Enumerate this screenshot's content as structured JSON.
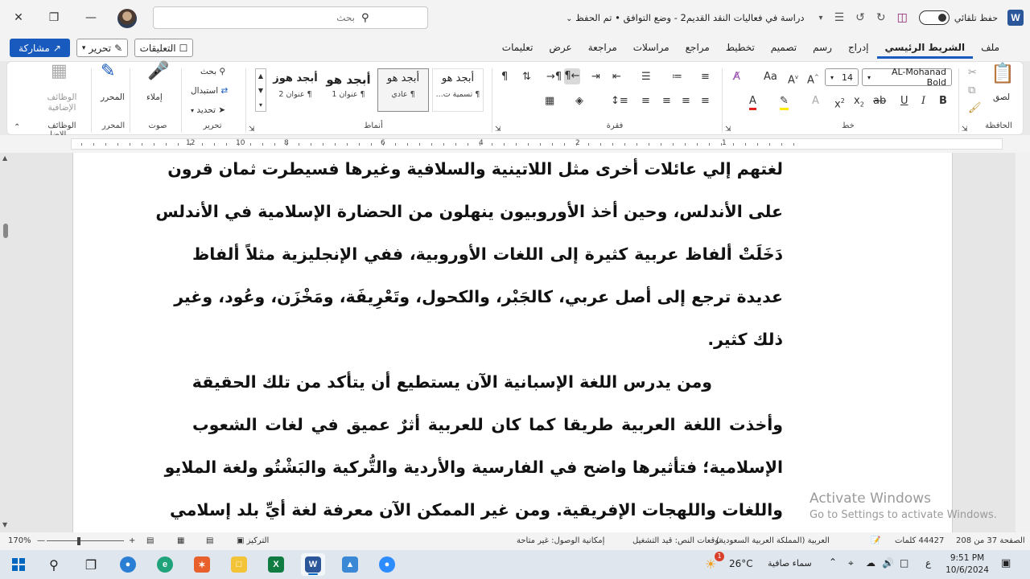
{
  "titlebar": {
    "doc_title": "دراسة في فعاليات النقد القديم2  -  وضع التوافق • تم الحفظ",
    "autosave_label": "حفظ تلقائي",
    "search_placeholder": "بحث",
    "app_letter": "W"
  },
  "tabs": [
    "ملف",
    "الشريط الرئيسي",
    "إدراج",
    "رسم",
    "تصميم",
    "تخطيط",
    "مراجع",
    "مراسلات",
    "مراجعة",
    "عرض",
    "تعليمات"
  ],
  "actions": {
    "share": "مشاركة",
    "edit": "تحرير",
    "comments": "التعليقات"
  },
  "ribbon": {
    "clipboard": {
      "paste": "لصق",
      "label": "الحافظة"
    },
    "font": {
      "name": "AL-Mohanad Bold",
      "size": "14",
      "label": "خط"
    },
    "paragraph": {
      "label": "فقرة"
    },
    "styles": {
      "label": "أنماط",
      "cards": [
        {
          "sample": "أبجد هو",
          "name": "¶ تسمية ت..."
        },
        {
          "sample": "أبجد هو",
          "name": "¶ عادي"
        },
        {
          "sample": "أبجد هو",
          "name": "¶ عنوان 1"
        },
        {
          "sample": "أبجد هوز",
          "name": "¶ عنوان 2"
        }
      ]
    },
    "editing": {
      "find": "بحث",
      "replace": "استبدال",
      "select": "تحديد",
      "label": "تحرير"
    },
    "voice": {
      "dictate": "إملاء",
      "label": "صوت"
    },
    "editor": {
      "editor": "المحرر",
      "label": "المحرر"
    },
    "addins": {
      "addins": "الوظائف الإضافية",
      "label": "الوظائف الإضا..."
    }
  },
  "ruler": {
    "numbers": [
      "12",
      "10",
      "8",
      "6",
      "4",
      "2",
      "1"
    ]
  },
  "document": {
    "lines": [
      "لغتهم إلي عائلات أخرى مثل اللاتينية والسلافية وغيرها فسيطرت ثمان قرون",
      "على الأندلس، وحين أخذ الأوروبيون ينهلون من الحضارة الإسلامية في الأندلس",
      "دَخَلَتْ ألفاظ عربية كثيرة إلى اللغات الأوروبية، ففي الإنجليزية مثلاً ألفاظ",
      "عديدة ترجع إلى أصل عربي، كالجَبْر، والكحول، وتَعْرِيفَة، ومَخْزَن، وعُود، وغير",
      "ذلك كثير.",
      "ومن يدرس اللغة الإسبانية الآن يستطيع أن يتأكد من تلك الحقيقة",
      "وأخذت اللغة العربية طريقا كما كان للعربية أثرٌ عميق في لغات الشعوب",
      "الإسلامية؛ فتأثيرها واضح في الفارسية والأردية والتُّركية والبَشْتُو ولغة الملايو",
      "واللغات واللهجات الإفريقية. ومن غير الممكن الآن معرفة لغة أيِّ بلد إسلامي"
    ]
  },
  "watermark": {
    "line1": "Activate Windows",
    "line2": "Go to Settings to activate Windows."
  },
  "statusbar": {
    "page": "الصفحة 37 من 208",
    "words": "44427 كلمات",
    "language": "العربية (المملكة العربية السعودية)",
    "predictions": "توقعات النص: قيد التشغيل",
    "accessibility": "إمكانية الوصول: غير متاحة",
    "focus": "التركيز",
    "zoom": "170%"
  },
  "taskbar": {
    "time": "9:51 PM",
    "date": "10/6/2024",
    "temp": "26°C",
    "weather": "سماء صافية",
    "lang": "ع",
    "badge": "1"
  }
}
